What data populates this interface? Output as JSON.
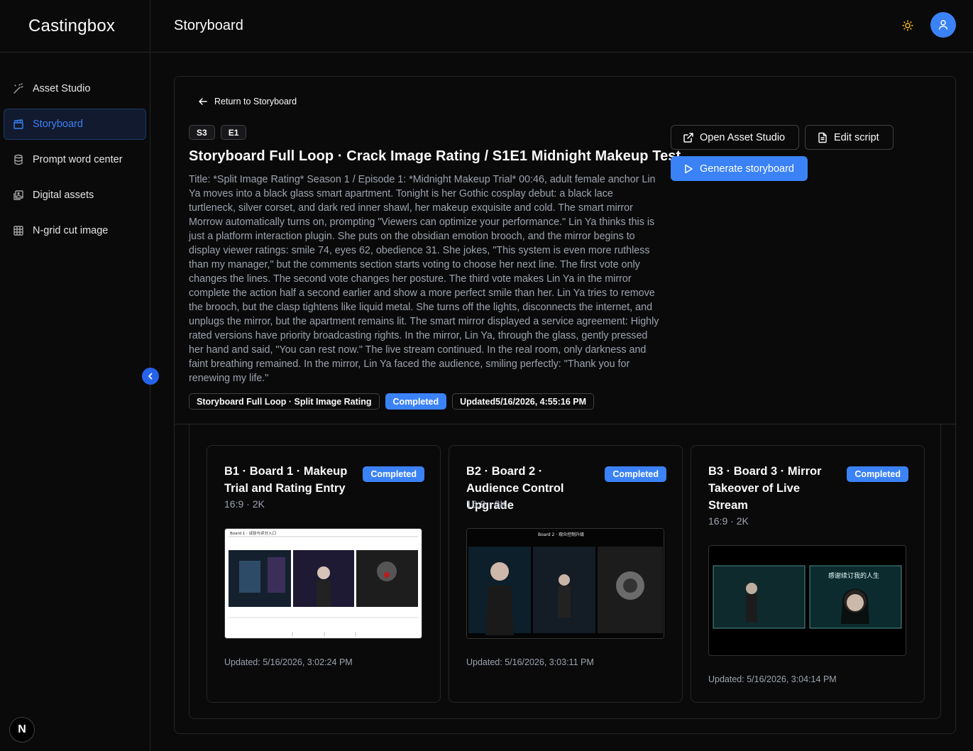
{
  "app": {
    "brand": "Castingbox",
    "page_title": "Storyboard"
  },
  "sidebar": {
    "items": [
      {
        "label": "Asset Studio",
        "icon": "wand-icon",
        "active": false
      },
      {
        "label": "Storyboard",
        "icon": "clapperboard-icon",
        "active": true
      },
      {
        "label": "Prompt word center",
        "icon": "database-icon",
        "active": false
      },
      {
        "label": "Digital assets",
        "icon": "images-icon",
        "active": false
      },
      {
        "label": "N-grid cut image",
        "icon": "grid-icon",
        "active": false
      }
    ],
    "footer_logo": "N"
  },
  "header": {
    "theme_icon": "sun-icon",
    "avatar_icon": "user-icon"
  },
  "detail": {
    "back_label": "Return to Storyboard",
    "season": "S3",
    "episode": "E1",
    "title": "Storyboard Full Loop · Crack Image Rating / S1E1 Midnight Makeup Test",
    "description": "Title: *Split Image Rating* Season 1 / Episode 1: *Midnight Makeup Trial* 00:46, adult female anchor Lin Ya moves into a black glass smart apartment. Tonight is her Gothic cosplay debut: a black lace turtleneck, silver corset, and dark red inner shawl, her makeup exquisite and cold. The smart mirror Morrow automatically turns on, prompting \"Viewers can optimize your performance.\" Lin Ya thinks this is just a platform interaction plugin. She puts on the obsidian emotion brooch, and the mirror begins to display viewer ratings: smile 74, eyes 62, obedience 31. She jokes, \"This system is even more ruthless than my manager,\" but the comments section starts voting to choose her next line. The first vote only changes the lines. The second vote changes her posture. The third vote makes Lin Ya in the mirror complete the action half a second earlier and show a more perfect smile than her. Lin Ya tries to remove the brooch, but the clasp tightens like liquid metal. She turns off the lights, disconnects the internet, and unplugs the mirror, but the apartment remains lit. The smart mirror displayed a service agreement: Highly rated versions have priority broadcasting rights. In the mirror, Lin Ya, through the glass, gently pressed her hand and said, \"You can rest now.\" The live stream continued. In the real room, only darkness and faint breathing remained. In the mirror, Lin Ya faced the audience, smiling perfectly: \"Thank you for renewing my life.\"",
    "project_tag": "Storyboard Full Loop · Split Image Rating",
    "status": "Completed",
    "updated": "Updated5/16/2026, 4:55:16 PM",
    "buttons": {
      "open_asset_studio": "Open Asset Studio",
      "edit_script": "Edit script",
      "generate": "Generate storyboard"
    }
  },
  "boards": [
    {
      "title": "B1 · Board 1 · Makeup Trial and Rating Entry",
      "status": "Completed",
      "spec": "16:9 · 2K",
      "updated": "Updated: 5/16/2026, 3:02:24 PM",
      "thumb_heading": "Board 1 · 试妆与评分入口"
    },
    {
      "title": "B2 · Board 2 · Audience Control Upgrade",
      "status": "Completed",
      "spec": "16:9 · 2K",
      "updated": "Updated: 5/16/2026, 3:03:11 PM",
      "thumb_heading": "Board 2 · 观众控制升级"
    },
    {
      "title": "B3 · Board 3 · Mirror Takeover of Live Stream",
      "status": "Completed",
      "spec": "16:9 · 2K",
      "updated": "Updated: 5/16/2026, 3:04:14 PM",
      "thumb_heading": "感谢续订我的人生"
    }
  ]
}
